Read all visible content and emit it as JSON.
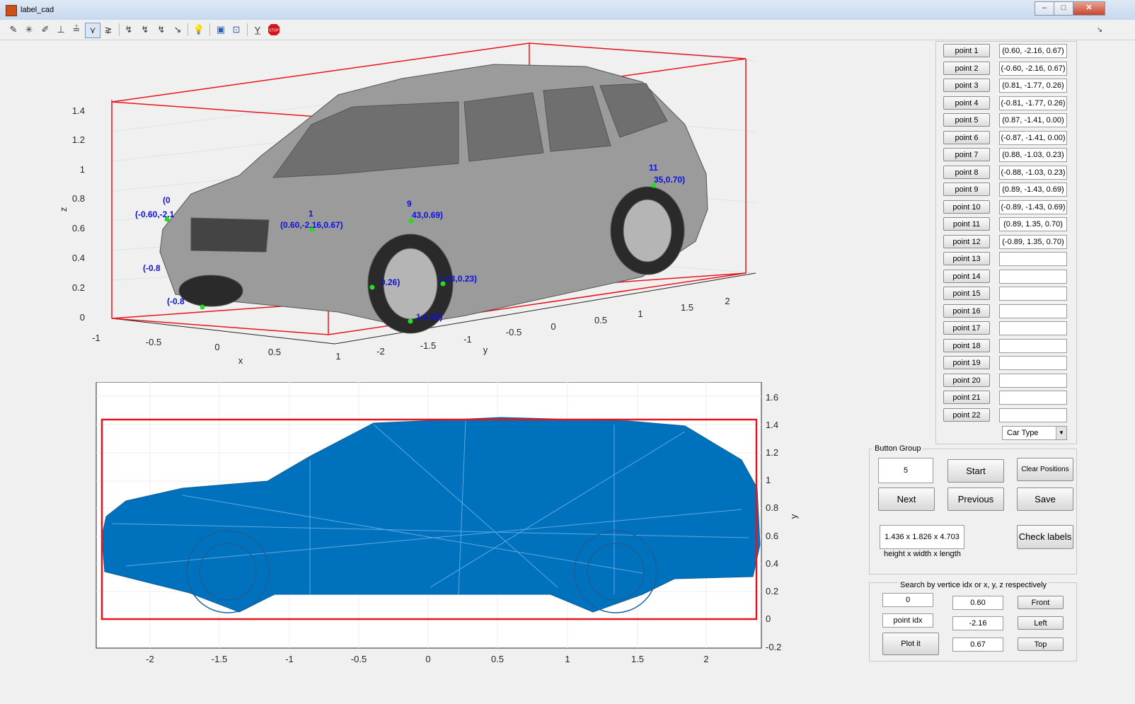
{
  "window": {
    "title": "label_cad"
  },
  "toolbar": {
    "icons": [
      "edit-plot-icon",
      "data-cursor-icon",
      "brush-icon",
      "link-icon",
      "insert-colorbar-icon",
      "insert-legend-icon",
      "pan-icon",
      "zoom-in-icon",
      "zoom-out-icon",
      "rotate-icon",
      "data-tip-icon",
      "light-icon",
      "camera-icon",
      "axis-icon",
      "plot-tools-icon",
      "stop-icon"
    ]
  },
  "axes3d": {
    "xlabel": "x",
    "ylabel": "y",
    "zlabel": "z",
    "x_ticks": [
      "-1",
      "-0.5",
      "0",
      "0.5",
      "1"
    ],
    "y_ticks": [
      "-2",
      "-1.5",
      "-1",
      "-0.5",
      "0",
      "0.5",
      "1",
      "1.5",
      "2"
    ],
    "z_ticks": [
      "0",
      "0.2",
      "0.4",
      "0.6",
      "0.8",
      "1",
      "1.2",
      "1.4"
    ],
    "labels": [
      {
        "id": "1",
        "text": "(0.60,-2.16,0.67)"
      },
      {
        "id": "9",
        "text": "43,0.69)"
      },
      {
        "id": "11",
        "text": "35,0.70)"
      },
      {
        "id": "2",
        "text": "(-0.60,-2.1"
      },
      {
        "id": "a",
        "text": "(0"
      },
      {
        "id": "b",
        "text": "(-0.8"
      },
      {
        "id": "c",
        "text": "(-0.8"
      },
      {
        "id": "d",
        "text": "0.26)"
      },
      {
        "id": "e",
        "text": "1.03,0.23)"
      },
      {
        "id": "f",
        "text": "1,0.00)"
      }
    ]
  },
  "axes2d": {
    "ylabel": "y",
    "x_ticks": [
      "-2",
      "-1.5",
      "-1",
      "-0.5",
      "0",
      "0.5",
      "1",
      "1.5",
      "2"
    ],
    "y_ticks": [
      "-0.2",
      "0",
      "0.2",
      "0.4",
      "0.6",
      "0.8",
      "1",
      "1.2",
      "1.4",
      "1.6"
    ]
  },
  "points": [
    {
      "label": "point 1",
      "value": "(0.60, -2.16, 0.67)"
    },
    {
      "label": "point 2",
      "value": "(-0.60, -2.16, 0.67)"
    },
    {
      "label": "point 3",
      "value": "(0.81, -1.77, 0.26)"
    },
    {
      "label": "point 4",
      "value": "(-0.81, -1.77, 0.26)"
    },
    {
      "label": "point 5",
      "value": "(0.87, -1.41, 0.00)"
    },
    {
      "label": "point 6",
      "value": "(-0.87, -1.41, 0.00)"
    },
    {
      "label": "point 7",
      "value": "(0.88, -1.03, 0.23)"
    },
    {
      "label": "point 8",
      "value": "(-0.88, -1.03, 0.23)"
    },
    {
      "label": "point 9",
      "value": "(0.89, -1.43, 0.69)"
    },
    {
      "label": "point 10",
      "value": "(-0.89, -1.43, 0.69)"
    },
    {
      "label": "point 11",
      "value": "(0.89, 1.35, 0.70)"
    },
    {
      "label": "point 12",
      "value": "(-0.89, 1.35, 0.70)"
    },
    {
      "label": "point 13",
      "value": ""
    },
    {
      "label": "point 14",
      "value": ""
    },
    {
      "label": "point 15",
      "value": ""
    },
    {
      "label": "point 16",
      "value": ""
    },
    {
      "label": "point 17",
      "value": ""
    },
    {
      "label": "point 18",
      "value": ""
    },
    {
      "label": "point 19",
      "value": ""
    },
    {
      "label": "point 20",
      "value": ""
    },
    {
      "label": "point 21",
      "value": ""
    },
    {
      "label": "point 22",
      "value": ""
    }
  ],
  "car_type": {
    "selected": "Car Type"
  },
  "button_group": {
    "title": "Button Group",
    "index_value": "5",
    "start": "Start",
    "clear": "Clear Positions",
    "next": "Next",
    "previous": "Previous",
    "save": "Save",
    "dimensions": "1.436 x 1.826 x 4.703",
    "dimensions_caption": "height x width x length",
    "check": "Check labels"
  },
  "search": {
    "title": "Search by vertice idx or x, y, z respectively",
    "idx_value": "0",
    "idx_label": "point idx",
    "plot": "Plot it",
    "x": "0.60",
    "y": "-2.16",
    "z": "0.67",
    "front": "Front",
    "left": "Left",
    "top": "Top"
  },
  "colors": {
    "mesh": "#0072bd",
    "box": "#e8141b",
    "label": "#1010e0",
    "marker": "#22dd22"
  }
}
